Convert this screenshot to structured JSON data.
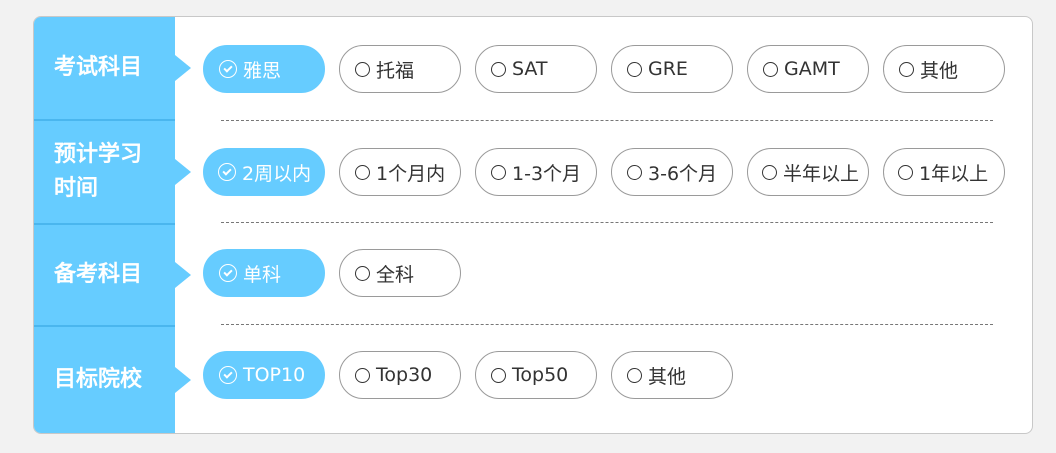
{
  "rows": [
    {
      "label": "考试科目",
      "options": [
        {
          "label": "雅思",
          "selected": true
        },
        {
          "label": "托福",
          "selected": false
        },
        {
          "label": "SAT",
          "selected": false
        },
        {
          "label": "GRE",
          "selected": false
        },
        {
          "label": "GAMT",
          "selected": false
        },
        {
          "label": "其他",
          "selected": false
        }
      ]
    },
    {
      "label_line1": "预计学习",
      "label_line2": "时间",
      "options": [
        {
          "label": "2周以内",
          "selected": true
        },
        {
          "label": "1个月内",
          "selected": false
        },
        {
          "label": "1-3个月",
          "selected": false
        },
        {
          "label": "3-6个月",
          "selected": false
        },
        {
          "label": "半年以上",
          "selected": false
        },
        {
          "label": "1年以上",
          "selected": false
        }
      ]
    },
    {
      "label": "备考科目",
      "options": [
        {
          "label": "单科",
          "selected": true
        },
        {
          "label": "全科",
          "selected": false
        }
      ]
    },
    {
      "label": "目标院校",
      "options": [
        {
          "label": "TOP10",
          "selected": true
        },
        {
          "label": "Top30",
          "selected": false
        },
        {
          "label": "Top50",
          "selected": false
        },
        {
          "label": "其他",
          "selected": false
        }
      ]
    }
  ],
  "colors": {
    "accent": "#66ccff",
    "border": "#9a9a9a",
    "text": "#333333"
  }
}
